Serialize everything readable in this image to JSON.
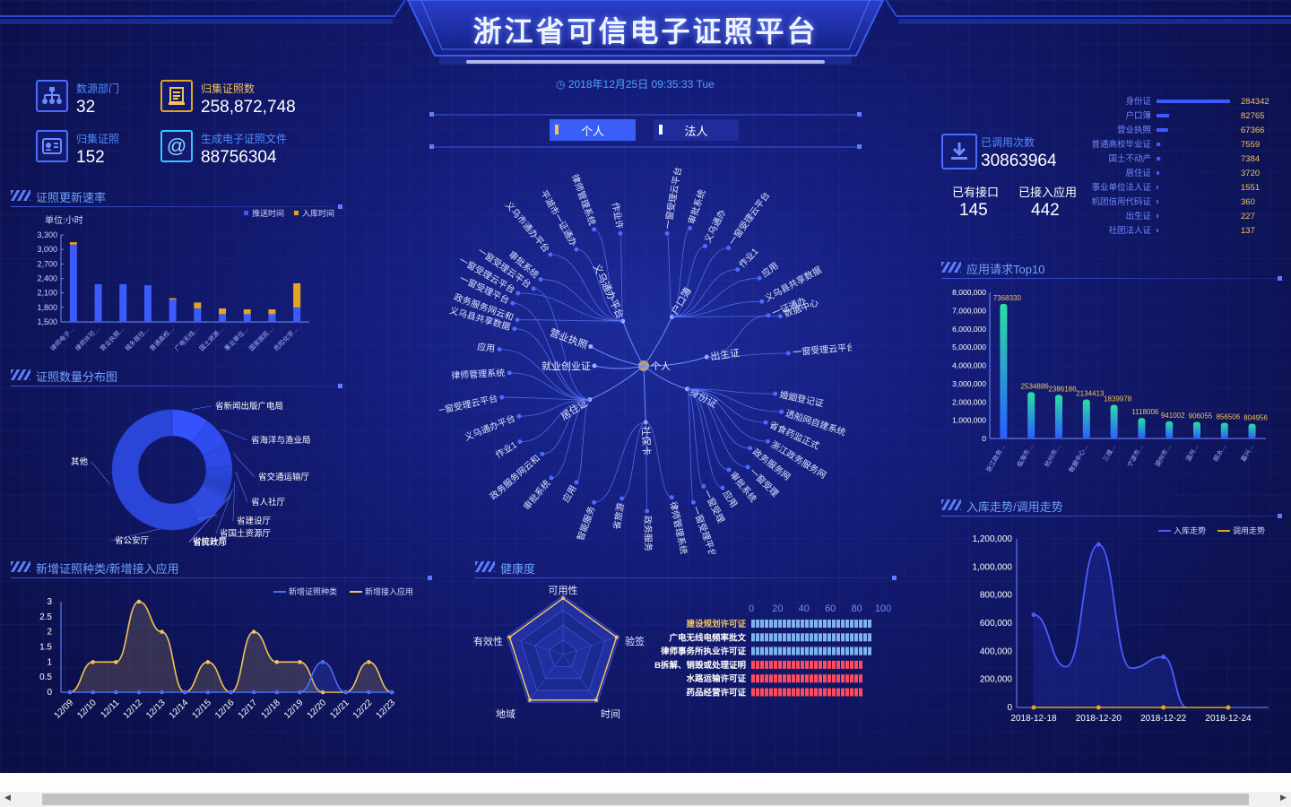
{
  "header": {
    "title": "浙江省可信电子证照平台",
    "datetime": "2018年12月25日 09:35:33 Tue"
  },
  "stats": [
    {
      "label": "数源部门",
      "value": "32",
      "icon": "org-chart-icon"
    },
    {
      "label": "归集证照数",
      "value": "258,872,748",
      "icon": "document-stack-icon"
    },
    {
      "label": "归集证照",
      "value": "152",
      "icon": "id-card-icon"
    },
    {
      "label": "生成电子证照文件",
      "value": "88756304",
      "icon": "at-sign-icon"
    }
  ],
  "right_stats": {
    "calls_label": "已调用次数",
    "calls_value": "30863964",
    "interfaces_label": "已有接口",
    "interfaces_value": "145",
    "apps_label": "已接入应用",
    "apps_value": "442"
  },
  "tabs": {
    "personal": "个人",
    "legal": "法人"
  },
  "sections": {
    "update_rate": "证照更新速率",
    "distribution": "证照数量分布图",
    "new_types": "新增证照种类/新增接入应用",
    "health": "健康度",
    "top10": "应用请求Top10",
    "trend": "入库走势/调用走势"
  },
  "cert_types": {
    "items": [
      {
        "name": "身份证",
        "value": "284342"
      },
      {
        "name": "户口簿",
        "value": "82765"
      },
      {
        "name": "营业执照",
        "value": "67366"
      },
      {
        "name": "普通高校毕业证",
        "value": "7559"
      },
      {
        "name": "国土不动产",
        "value": "7384"
      },
      {
        "name": "居住证",
        "value": "3720"
      },
      {
        "name": "事业单位法人证",
        "value": "1551"
      },
      {
        "name": "机团信用代码证",
        "value": "360"
      },
      {
        "name": "出生证",
        "value": "227"
      },
      {
        "name": "社团法人证",
        "value": "137"
      }
    ]
  },
  "chart_data": [
    {
      "type": "bar",
      "unit_label": "单位:小时",
      "legend": [
        "推送时间",
        "入库时间"
      ],
      "categories": [
        "律师电子…",
        "律师许可…",
        "营业执照…",
        "城乡居住…",
        "普通高校…",
        "广电无线…",
        "国土资源…",
        "事业单位…",
        "国家居民…",
        "危险化学…"
      ],
      "series": [
        {
          "name": "推送时间",
          "values": [
            3100,
            2280,
            2280,
            2260,
            1960,
            1780,
            1660,
            1660,
            1660,
            1800
          ],
          "color": "#3b5bff"
        },
        {
          "name": "入库时间",
          "values": [
            50,
            0,
            0,
            0,
            30,
            120,
            120,
            100,
            100,
            500
          ],
          "color": "#e3a520"
        }
      ],
      "ylim": [
        1500,
        3300
      ],
      "yticks": [
        "3,300",
        "3,000",
        "2,700",
        "2,400",
        "2,100",
        "1,800",
        "1,500"
      ]
    },
    {
      "type": "pie",
      "labels": [
        "省新闻出版广电局",
        "省海洋与渔业局",
        "省交通运输厅",
        "省人社厅",
        "省建设厅",
        "省国土资源厅",
        "省民政厅",
        "省统计局",
        "省公安厅",
        "其他"
      ],
      "values": [
        10,
        8,
        6,
        3,
        2,
        1.5,
        1,
        1,
        10,
        57.5
      ]
    },
    {
      "type": "line",
      "legend": [
        "新增证照种类",
        "新增接入应用"
      ],
      "categories": [
        "12/09",
        "12/10",
        "12/11",
        "12/12",
        "12/13",
        "12/14",
        "12/15",
        "12/16",
        "12/17",
        "12/18",
        "12/19",
        "12/20",
        "12/21",
        "12/22",
        "12/23"
      ],
      "series": [
        {
          "name": "新增证照种类",
          "values": [
            0,
            0,
            0,
            0,
            0,
            0,
            0,
            0,
            0,
            0,
            0,
            1,
            0,
            0,
            0
          ],
          "color": "#4b6cff"
        },
        {
          "name": "新增接入应用",
          "values": [
            0,
            1,
            1,
            3,
            2,
            0,
            1,
            0,
            2,
            1,
            1,
            0,
            0,
            1,
            0
          ],
          "color": "#f1c35a"
        }
      ],
      "ylim": [
        0,
        3
      ],
      "yticks": [
        "3",
        "2.5",
        "2",
        "1.5",
        "1",
        "0.5",
        "0"
      ]
    },
    {
      "type": "radar",
      "axes": [
        "可用性",
        "验签",
        "时间",
        "地域",
        "有效性"
      ],
      "values": [
        0.95,
        0.95,
        0.95,
        0.95,
        0.95
      ]
    },
    {
      "type": "bar",
      "orientation": "horizontal",
      "xticks": [
        "0",
        "20",
        "40",
        "60",
        "80",
        "100"
      ],
      "categories": [
        "建设规划许可证",
        "广电无线电频率批文",
        "律师事务所执业许可证",
        "B拆解、销毁或处理证明",
        "水路运输许可证",
        "药品经营许可证"
      ],
      "values": [
        100,
        100,
        100,
        92,
        92,
        92
      ],
      "colors": [
        "#7fb3ee",
        "#7fb3ee",
        "#7fb3ee",
        "#ff4b5c",
        "#ff4b5c",
        "#ff4b5c"
      ]
    },
    {
      "type": "bar",
      "categories": [
        "浙江政务…",
        "临海市…",
        "杭州市…",
        "数据中心…",
        "三维…",
        "宁波市…",
        "湖州市…",
        "温州…",
        "丽水…",
        "嘉兴…"
      ],
      "values": [
        7368330,
        2534886,
        2386186,
        2134413,
        1839978,
        1118006,
        941002,
        906055,
        856506,
        804956
      ],
      "labels": [
        "7368330",
        "2534886",
        "2386186",
        "2134413",
        "1839978",
        "1118006",
        "941002",
        "906055",
        "856506",
        "804956"
      ],
      "ylim": [
        0,
        8000000
      ],
      "yticks": [
        "8,000,000",
        "7,000,000",
        "6,000,000",
        "5,000,000",
        "4,000,000",
        "3,000,000",
        "2,000,000",
        "1,000,000",
        "0"
      ]
    },
    {
      "type": "line",
      "legend": [
        "入库走势",
        "调用走势"
      ],
      "x": [
        "2018-12-18",
        "2018-12-19",
        "2018-12-20",
        "2018-12-21",
        "2018-12-22",
        "2018-12-23",
        "2018-12-24"
      ],
      "xticks": [
        "2018-12-18",
        "2018-12-20",
        "2018-12-22",
        "2018-12-24"
      ],
      "series": [
        {
          "name": "入库走势",
          "values": [
            660000,
            290000,
            1160000,
            280000,
            360000,
            0,
            0
          ],
          "color": "#4b5cff"
        },
        {
          "name": "调用走势",
          "values": [
            0,
            0,
            0,
            0,
            0,
            0,
            0
          ],
          "color": "#e3a520"
        }
      ],
      "ylim": [
        0,
        1200000
      ],
      "yticks": [
        "1,200,000",
        "1,000,000",
        "800,000",
        "600,000",
        "400,000",
        "200,000",
        "0"
      ]
    }
  ],
  "tree": {
    "center": "个人",
    "branches": [
      {
        "name": "义乌通办平台",
        "leaves": [
          "政务服务网云和",
          "一窗受理云平台",
          "审批系统",
          "义乌市通办平台",
          "平湖市一证通办",
          "律师管理系统",
          "作业许"
        ]
      },
      {
        "name": "户口簿",
        "leaves": [
          "一窗受理云平台",
          "审批系统",
          "义乌通办",
          "一窗受理云平台",
          "作业1",
          "应用",
          "义乌县共享数据",
          "数据中心"
        ]
      },
      {
        "name": "出生证",
        "leaves": [
          "一证通办",
          "一窗受理云平台"
        ]
      },
      {
        "name": "身份证",
        "leaves": [
          "婚姻登记证",
          "透船网自建系统",
          "省食药监正式",
          "浙江政务服务网",
          "政务服务网",
          "一窗受理",
          "审批系统",
          "应用",
          "一窗受理",
          "一窗受理平台"
        ]
      },
      {
        "name": "社保卡",
        "leaves": [
          "律师管理系统",
          "政务服务",
          "省旅游",
          "智能服务"
        ]
      },
      {
        "name": "居住证",
        "leaves": [
          "应用",
          "审批系统",
          "政务服务网云和",
          "作业1",
          "义乌通办平台",
          "一窗受理云平台",
          "律师管理系统",
          "应用",
          "义乌县共享数据",
          "一窗受理平台",
          "一窗受理云平台"
        ]
      },
      {
        "name": "就业创业证",
        "leaves": []
      },
      {
        "name": "营业执照",
        "leaves": []
      }
    ]
  },
  "scrollbar": {
    "left_arrow": "◀",
    "right_arrow": "▶"
  }
}
